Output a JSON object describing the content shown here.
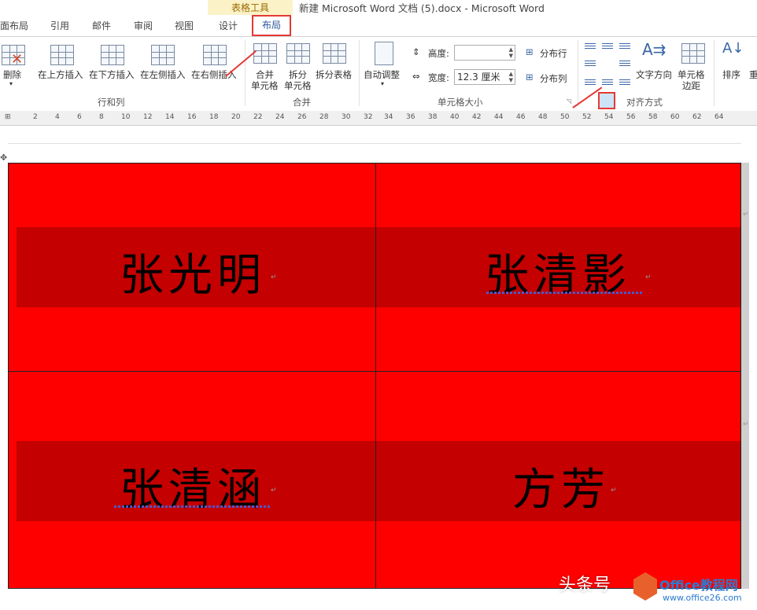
{
  "tabs": {
    "page_layout": "面布局",
    "references": "引用",
    "mailings": "邮件",
    "review": "审阅",
    "view": "视图",
    "design": "设计",
    "layout": "布局"
  },
  "context_tab_group": "表格工具",
  "window_title": "新建 Microsoft Word 文档 (5).docx - Microsoft Word",
  "ribbon": {
    "delete": "删除",
    "insert_above": "在上方插入",
    "insert_below": "在下方插入",
    "insert_left": "在左侧插入",
    "insert_right": "在右侧插入",
    "group_rows_cols": "行和列",
    "merge_cells_1": "合并",
    "merge_cells_2": "单元格",
    "split_cells_1": "拆分",
    "split_cells_2": "单元格",
    "split_table": "拆分表格",
    "group_merge": "合并",
    "autofit": "自动调整",
    "height_label": "高度:",
    "height_value": "",
    "width_label": "宽度:",
    "width_value": "12.3 厘米",
    "distribute_rows": "分布行",
    "distribute_cols": "分布列",
    "group_cell_size": "单元格大小",
    "text_direction": "文字方向",
    "cell_margins_1": "单元格",
    "cell_margins_2": "边距",
    "group_alignment": "对齐方式",
    "sort": "排序",
    "repeat": "重"
  },
  "ruler": {
    "left_ticks": [
      "2",
      "4",
      "6",
      "8",
      "10",
      "12",
      "14",
      "16",
      "18",
      "20",
      "22",
      "24",
      "26",
      "28",
      "30",
      "32"
    ],
    "right_ticks": [
      "34",
      "36",
      "38",
      "40",
      "42",
      "44",
      "46",
      "48",
      "50",
      "52",
      "54",
      "56",
      "58",
      "60",
      "62",
      "64"
    ]
  },
  "table_cells": [
    {
      "name": "张光明"
    },
    {
      "name": "张清影"
    },
    {
      "name": "张清涵"
    },
    {
      "name": "方芳"
    }
  ],
  "watermark": {
    "text": "头条号",
    "site": "Office教程网",
    "url": "www.office26.com"
  },
  "colors": {
    "cell_fill": "#ff0000",
    "text_band": "#c40000",
    "highlight_border": "#e53935",
    "accent": "#2b579a"
  }
}
